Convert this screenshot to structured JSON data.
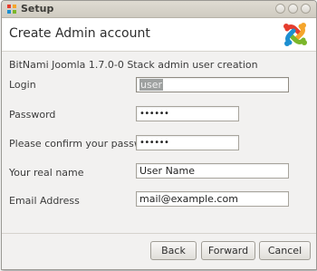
{
  "window": {
    "title": "Setup"
  },
  "header": {
    "title": "Create Admin account"
  },
  "subtitle": "BitNami Joomla 1.7.0-0 Stack admin user creation",
  "form": {
    "login": {
      "label": "Login",
      "value": "user"
    },
    "password": {
      "label": "Password",
      "value": "••••••"
    },
    "confirm": {
      "label": "Please confirm your password",
      "value": "••••••"
    },
    "realname": {
      "label": "Your real name",
      "value": "User Name"
    },
    "email": {
      "label": "Email Address",
      "value": "mail@example.com"
    }
  },
  "buttons": {
    "back": "Back",
    "forward": "Forward",
    "cancel": "Cancel"
  },
  "colors": {
    "window_bg": "#f2f1f0",
    "selection": "#9ea1a0",
    "titlebar": "#dfdbd2"
  },
  "icons": {
    "app": "joomla-icon",
    "logo": "joomla-logo"
  }
}
